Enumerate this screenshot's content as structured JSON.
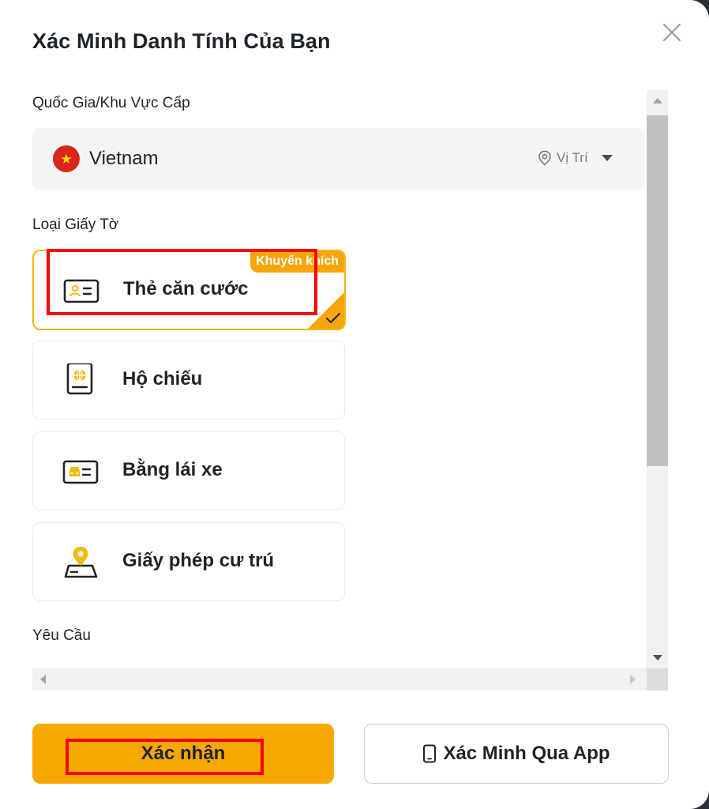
{
  "dialog": {
    "title": "Xác Minh Danh Tính Của Bạn"
  },
  "country_section": {
    "label": "Quốc Gia/Khu Vực Cấp",
    "selected_country": "Vietnam",
    "flag_icon": "vietnam-flag-icon",
    "location_label": "Vị Trí"
  },
  "document_section": {
    "label": "Loại Giấy Tờ",
    "options": [
      {
        "label": "Thẻ căn cước",
        "icon": "id-card-icon",
        "selected": true,
        "badge": "Khuyến khích"
      },
      {
        "label": "Hộ chiếu",
        "icon": "passport-icon",
        "selected": false
      },
      {
        "label": "Bằng lái xe",
        "icon": "driver-license-icon",
        "selected": false
      },
      {
        "label": "Giấy phép cư trú",
        "icon": "residence-permit-icon",
        "selected": false
      }
    ]
  },
  "requirements_section": {
    "label": "Yêu Cầu"
  },
  "footer": {
    "confirm_label": "Xác nhận",
    "app_verify_label": "Xác Minh Qua App"
  },
  "colors": {
    "accent": "#f6a800",
    "badge": "#f6a50a",
    "highlight": "#ff0000",
    "flag_red": "#da251d",
    "flag_star": "#ffde00"
  }
}
